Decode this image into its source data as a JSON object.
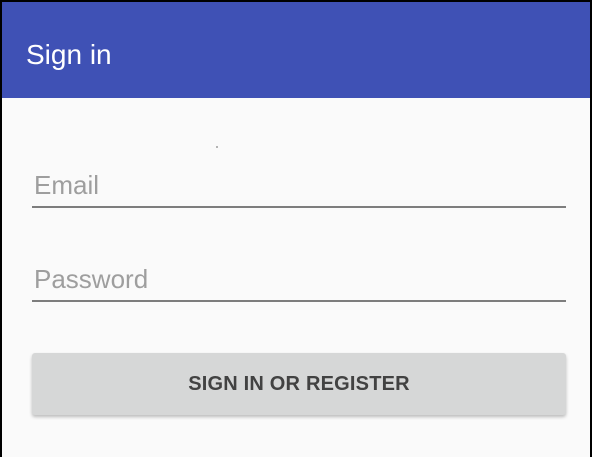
{
  "app_bar": {
    "title": "Sign in",
    "background_color": "#3f51b5"
  },
  "form": {
    "email_placeholder": "Email",
    "email_value": "",
    "password_placeholder": "Password",
    "password_value": "",
    "submit_label": "SIGN IN OR REGISTER"
  }
}
